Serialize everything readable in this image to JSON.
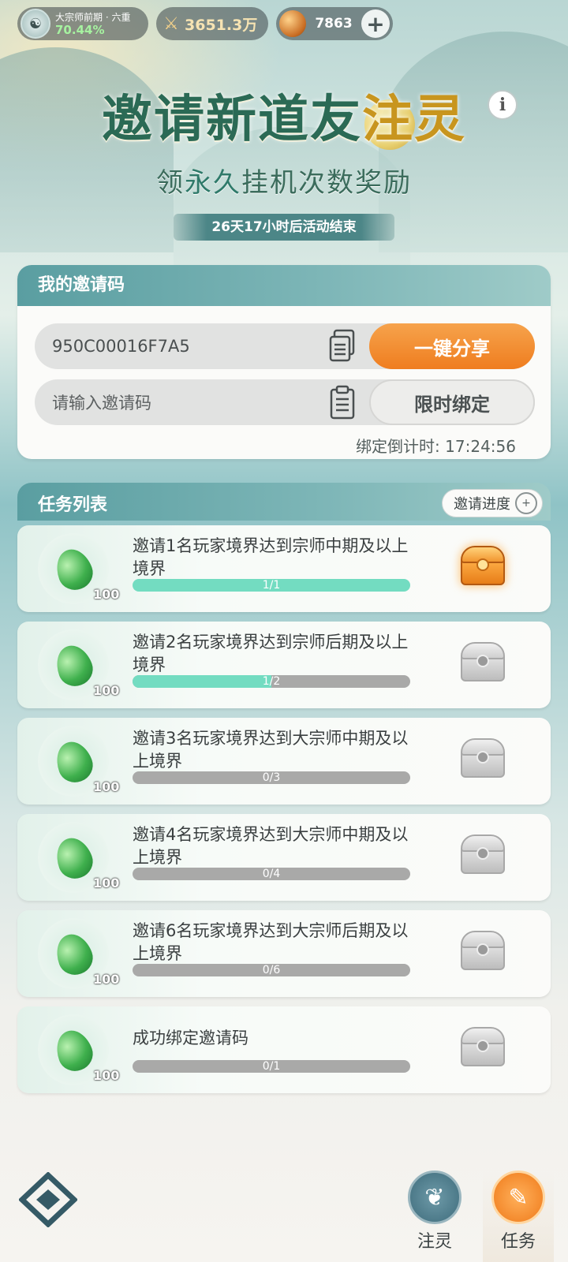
{
  "status_bar": {
    "rank_name": "大宗师前期 · 六重",
    "rank_percent": "70.44%",
    "power": "3651.3万",
    "currency": "7863"
  },
  "header": {
    "title_main": "邀请新道友",
    "title_accent": "注灵",
    "subtitle_pre": "领",
    "subtitle_em": "永久",
    "subtitle_post": "挂机次数奖励",
    "countdown": "26天17小时后活动结束"
  },
  "invite": {
    "header": "我的邀请码",
    "my_code": "950C00016F7A5",
    "share_label": "一键分享",
    "input_placeholder": "请输入邀请码",
    "bind_label": "限时绑定",
    "bind_timer_label": "绑定倒计时:",
    "bind_timer_value": "17:24:56"
  },
  "tasks": {
    "header": "任务列表",
    "progress_button": "邀请进度",
    "items": [
      {
        "desc": "邀请1名玩家境界达到宗师中期及以上境界",
        "reward": "100",
        "progress_label": "1/1",
        "progress": 1.0,
        "chest": "gold"
      },
      {
        "desc": "邀请2名玩家境界达到宗师后期及以上境界",
        "reward": "100",
        "progress_label": "1/2",
        "progress": 0.5,
        "chest": "grey"
      },
      {
        "desc": "邀请3名玩家境界达到大宗师中期及以上境界",
        "reward": "100",
        "progress_label": "0/3",
        "progress": 0.0,
        "chest": "grey"
      },
      {
        "desc": "邀请4名玩家境界达到大宗师中期及以上境界",
        "reward": "100",
        "progress_label": "0/4",
        "progress": 0.0,
        "chest": "grey"
      },
      {
        "desc": "邀请6名玩家境界达到大宗师后期及以上境界",
        "reward": "100",
        "progress_label": "0/6",
        "progress": 0.0,
        "chest": "grey"
      },
      {
        "desc": "成功绑定邀请码",
        "reward": "100",
        "progress_label": "0/1",
        "progress": 0.0,
        "chest": "grey"
      }
    ]
  },
  "nav": {
    "lingzhu_label": "注灵",
    "task_label": "任务"
  },
  "colors": {
    "accent_orange": "#ef7d1f",
    "progress_teal": "#73dcc1",
    "header_teal": "#5a9ea1"
  }
}
